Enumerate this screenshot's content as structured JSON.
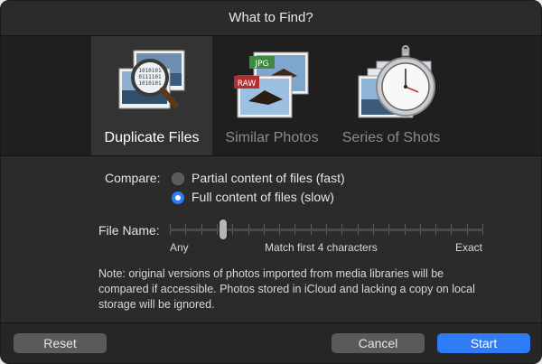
{
  "window": {
    "title": "What to Find?"
  },
  "modes": [
    {
      "label": "Duplicate Files",
      "selected": true,
      "icon": "duplicate-files-magnifier-icon"
    },
    {
      "label": "Similar Photos",
      "selected": false,
      "icon": "similar-photos-icon"
    },
    {
      "label": "Series of Shots",
      "selected": false,
      "icon": "series-of-shots-stopwatch-icon"
    }
  ],
  "icon_badges": {
    "jpg": "JPG",
    "raw": "RAW"
  },
  "compare": {
    "label": "Compare:",
    "options": [
      {
        "label": "Partial content of files (fast)",
        "selected": false
      },
      {
        "label": "Full content of files (slow)",
        "selected": true
      }
    ]
  },
  "file_name": {
    "label": "File Name:",
    "slider_level": 0.17,
    "tick_count": 21,
    "labels": {
      "min": "Any",
      "mid": "Match first 4 characters",
      "max": "Exact"
    }
  },
  "note": "Note: original versions of photos imported from media libraries will be compared if accessible. Photos stored in iCloud and lacking a copy on local storage will be ignored.",
  "buttons": {
    "reset": "Reset",
    "cancel": "Cancel",
    "start": "Start"
  },
  "colors": {
    "accent": "#2f7bf5",
    "background": "#2b2b2b"
  }
}
